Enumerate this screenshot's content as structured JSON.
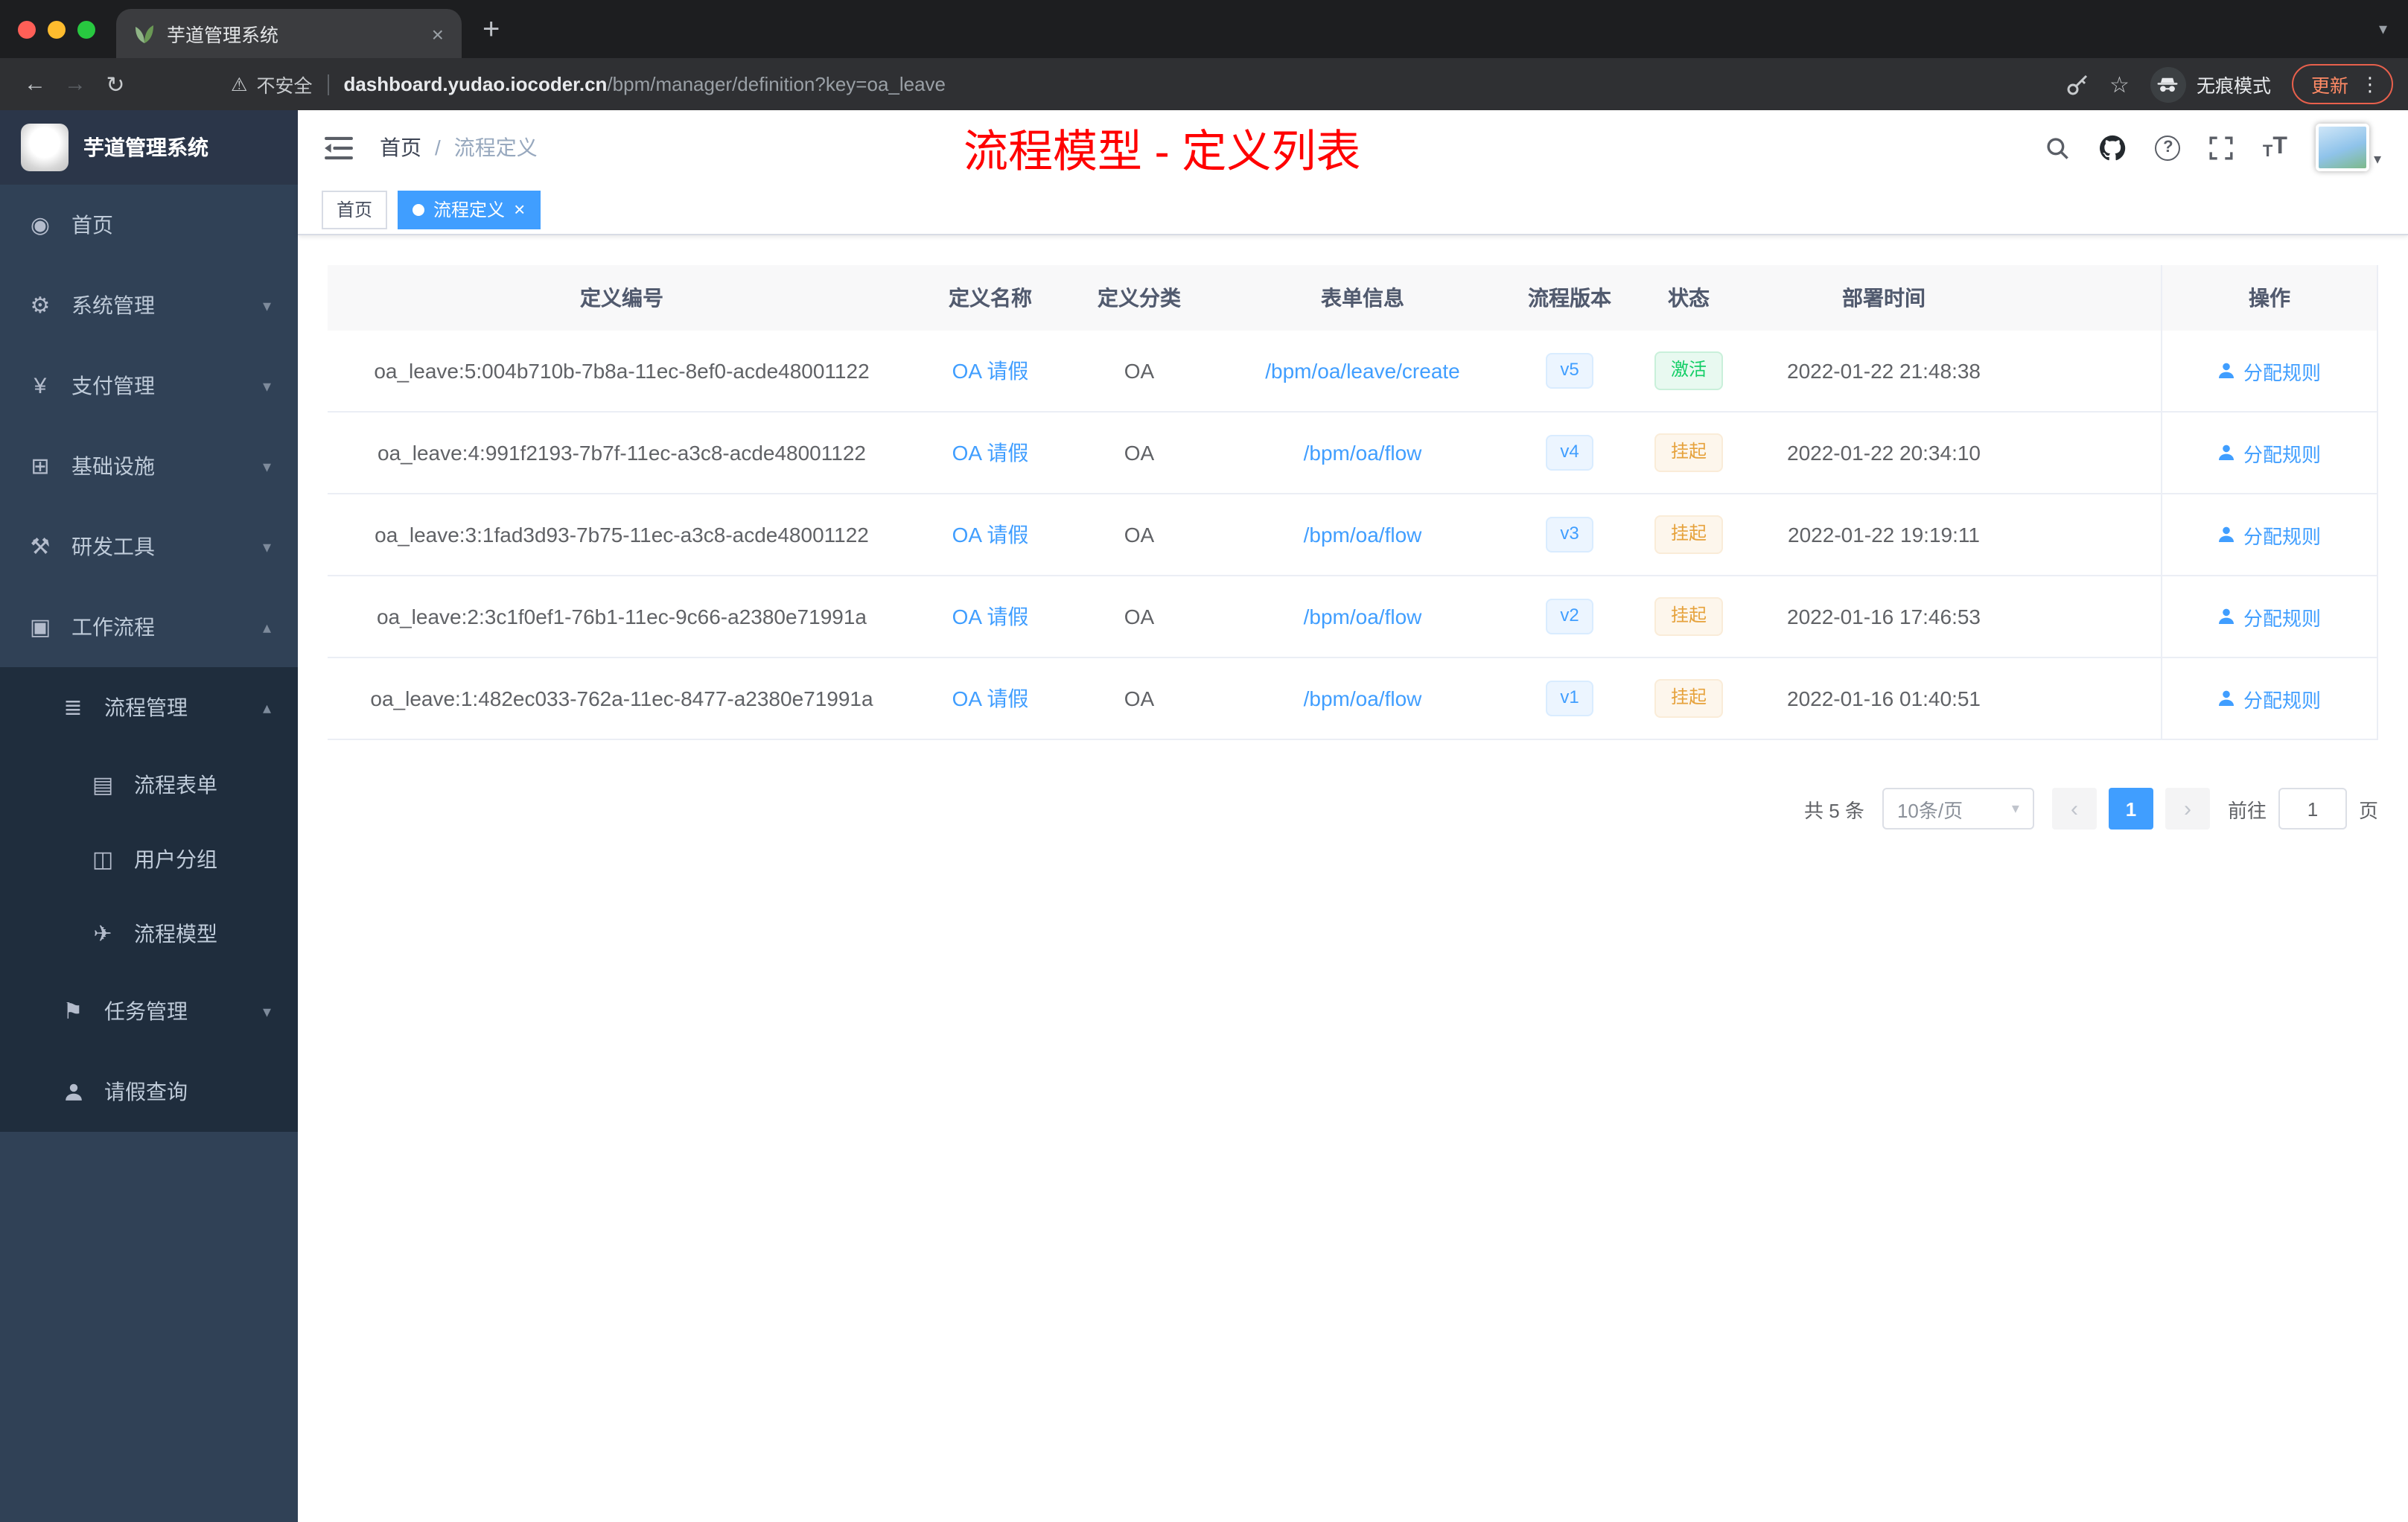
{
  "browser": {
    "tab_title": "芋道管理系统",
    "security_label": "不安全",
    "url_host": "dashboard.yudao.iocoder.cn",
    "url_path": "/bpm/manager/definition?key=oa_leave",
    "incognito_label": "无痕模式",
    "update_label": "更新"
  },
  "sidebar": {
    "logo_title": "芋道管理系统",
    "items": [
      {
        "label": "首页",
        "icon": "◉"
      },
      {
        "label": "系统管理",
        "icon": "⚙",
        "caret": "▾"
      },
      {
        "label": "支付管理",
        "icon": "¥",
        "caret": "▾"
      },
      {
        "label": "基础设施",
        "icon": "⊞",
        "caret": "▾"
      },
      {
        "label": "研发工具",
        "icon": "⚒",
        "caret": "▾"
      },
      {
        "label": "工作流程",
        "icon": "▣",
        "caret": "▴"
      }
    ],
    "process_group": {
      "label": "流程管理",
      "icon": "≣",
      "caret": "▴"
    },
    "process_children": [
      {
        "label": "流程表单",
        "icon": "▤"
      },
      {
        "label": "用户分组",
        "icon": "◫"
      },
      {
        "label": "流程模型",
        "icon": "✈"
      }
    ],
    "task_group": {
      "label": "任务管理",
      "icon": "⚑",
      "caret": "▾"
    },
    "leave_item": {
      "label": "请假查询"
    }
  },
  "header": {
    "breadcrumb_home": "首页",
    "breadcrumb_separator": "/",
    "breadcrumb_current": "流程定义",
    "annotation": "流程模型 - 定义列表"
  },
  "tags": {
    "home": "首页",
    "active": "流程定义"
  },
  "table": {
    "columns": [
      "定义编号",
      "定义名称",
      "定义分类",
      "表单信息",
      "流程版本",
      "状态",
      "部署时间",
      "操作"
    ],
    "rows": [
      {
        "id": "oa_leave:5:004b710b-7b8a-11ec-8ef0-acde48001122",
        "name": "OA 请假",
        "category": "OA",
        "form": "/bpm/oa/leave/create",
        "version": "v5",
        "status": "激活",
        "status_type": "success",
        "time": "2022-01-22 21:48:38",
        "action": "分配规则"
      },
      {
        "id": "oa_leave:4:991f2193-7b7f-11ec-a3c8-acde48001122",
        "name": "OA 请假",
        "category": "OA",
        "form": "/bpm/oa/flow",
        "version": "v4",
        "status": "挂起",
        "status_type": "warning",
        "time": "2022-01-22 20:34:10",
        "action": "分配规则"
      },
      {
        "id": "oa_leave:3:1fad3d93-7b75-11ec-a3c8-acde48001122",
        "name": "OA 请假",
        "category": "OA",
        "form": "/bpm/oa/flow",
        "version": "v3",
        "status": "挂起",
        "status_type": "warning",
        "time": "2022-01-22 19:19:11",
        "action": "分配规则"
      },
      {
        "id": "oa_leave:2:3c1f0ef1-76b1-11ec-9c66-a2380e71991a",
        "name": "OA 请假",
        "category": "OA",
        "form": "/bpm/oa/flow",
        "version": "v2",
        "status": "挂起",
        "status_type": "warning",
        "time": "2022-01-16 17:46:53",
        "action": "分配规则"
      },
      {
        "id": "oa_leave:1:482ec033-762a-11ec-8477-a2380e71991a",
        "name": "OA 请假",
        "category": "OA",
        "form": "/bpm/oa/flow",
        "version": "v1",
        "status": "挂起",
        "status_type": "warning",
        "time": "2022-01-16 01:40:51",
        "action": "分配规则"
      }
    ]
  },
  "pagination": {
    "total": "共 5 条",
    "page_size": "10条/页",
    "current_page": "1",
    "goto_label": "前往",
    "goto_value": "1",
    "page_unit": "页"
  },
  "glyphs": {
    "back": "←",
    "forward": "→",
    "reload": "↻",
    "warning": "⚠",
    "star": "☆",
    "menu_dots": "⋮",
    "tab_close": "×",
    "new_tab": "+",
    "strip_caret": "▾",
    "question": "?",
    "font_small": "T",
    "font_large": "T",
    "avatar_caret": "▾",
    "caret_down": "▾",
    "prev": "‹",
    "next": "›",
    "tag_close": "×"
  },
  "colors": {
    "accent": "#409eff",
    "success": "#13ce66",
    "warning": "#e6a23c",
    "annotation_red": "#ff0000",
    "sidebar_bg": "#304156",
    "sidebar_sub_bg": "#1f2d3d"
  }
}
